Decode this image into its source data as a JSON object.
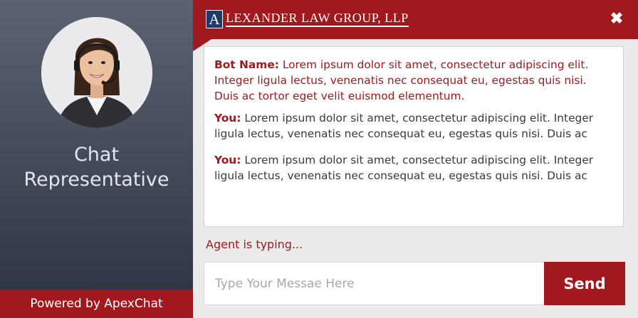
{
  "left_panel": {
    "title_line1": "Chat",
    "title_line2": "Representative",
    "powered_by": "Powered by ApexChat",
    "avatar_icon": "agent-avatar-icon"
  },
  "header": {
    "logo_initial": "A",
    "logo_text": "LEXANDER LAW GROUP, LLP",
    "close_label": "✖",
    "color": "#a1191e"
  },
  "messages": [
    {
      "who": "Bot Name",
      "type": "bot",
      "text": "Lorem ipsum dolor sit amet, consectetur adipiscing elit. Integer ligula lectus, venenatis nec consequat eu, egestas quis nisi. Duis ac tortor eget velit euismod elementum."
    },
    {
      "who": "You",
      "type": "you",
      "text": "Lorem ipsum dolor sit amet, consectetur adipiscing elit. Integer ligula lectus, venenatis nec consequat eu, egestas quis nisi. Duis ac"
    },
    {
      "who": "You",
      "type": "you",
      "text": "Lorem ipsum dolor sit amet, consectetur adipiscing elit. Integer ligula lectus, venenatis nec consequat eu, egestas quis nisi. Duis ac"
    }
  ],
  "status": {
    "typing": "Agent is typing..."
  },
  "composer": {
    "placeholder": "Type Your Messae Here",
    "value": "",
    "send_label": "Send"
  },
  "colors": {
    "accent": "#a1191e",
    "panel_dark": "#414858",
    "logo_box": "#1d3a6b"
  }
}
